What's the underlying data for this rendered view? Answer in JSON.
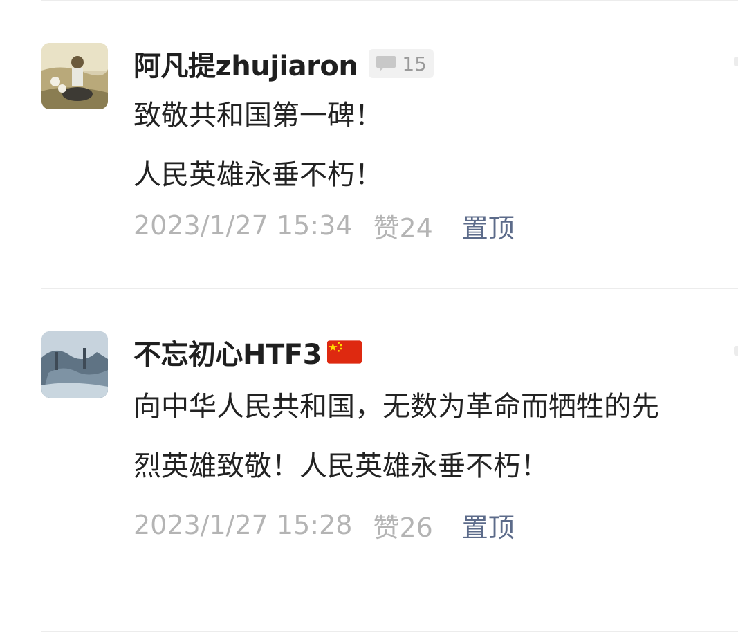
{
  "comments": [
    {
      "username": "阿凡提zhujiaron",
      "reply_count": "15",
      "icons": {
        "reply": "comment-bubble-icon"
      },
      "lines": [
        "致敬共和国第一碑！",
        "人民英雄永垂不朽！"
      ],
      "timestamp": "2023/1/27 15:34",
      "like_text": "赞24",
      "pin_label": "置顶"
    },
    {
      "username": "不忘初心HTF3",
      "badge_icon": "china-flag-icon",
      "text": "向中华人民共和国，无数为革命而牺牲的先烈英雄致敬！人民英雄永垂不朽！",
      "timestamp": "2023/1/27 15:28",
      "like_text": "赞26",
      "pin_label": "置顶"
    }
  ],
  "colors": {
    "pin": "#5c6b8a",
    "meta": "#b4b4b4",
    "divider": "#ececec",
    "flag_red": "#de2910",
    "flag_yellow": "#ffde00"
  }
}
